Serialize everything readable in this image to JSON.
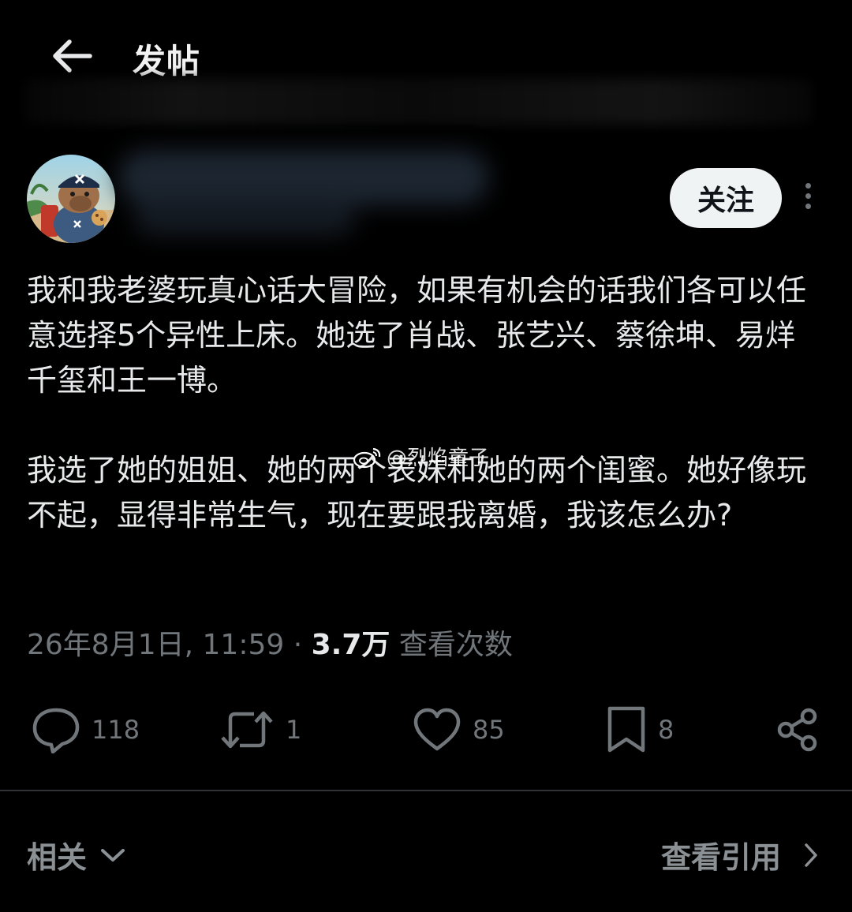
{
  "header": {
    "back_icon": "arrow-left-icon",
    "title": "发帖"
  },
  "author": {
    "avatar": "capybara-avatar",
    "follow_label": "关注",
    "more_icon": "more-vertical-icon"
  },
  "post": {
    "paragraphs": [
      "我和我老婆玩真心话大冒险，如果有机会的话我们各可以任意选择5个异性上床。她选了肖战、张艺兴、蔡徐坤、易烊千玺和王一博。",
      "我选了她的姐姐、她的两个表妹和她的两个闺蜜。她好像玩不起，显得非常生气，现在要跟我离婚，我该怎么办?"
    ],
    "watermark": "@烈焰童子",
    "timestamp": "26年8月1日, 11:59",
    "separator": "·",
    "views_count": "3.7万",
    "views_label": "查看次数"
  },
  "actions": {
    "reply": {
      "icon": "reply-icon",
      "count": "118"
    },
    "repost": {
      "icon": "repost-icon",
      "count": "1"
    },
    "like": {
      "icon": "heart-icon",
      "count": "85"
    },
    "bookmark": {
      "icon": "bookmark-icon",
      "count": "8"
    },
    "share": {
      "icon": "share-icon"
    }
  },
  "footer": {
    "related_label": "相关",
    "quotes_label": "查看引用"
  },
  "colors": {
    "background": "#000000",
    "text": "#e7e9ea",
    "muted": "#71767b",
    "follow_bg": "#eff3f4"
  }
}
